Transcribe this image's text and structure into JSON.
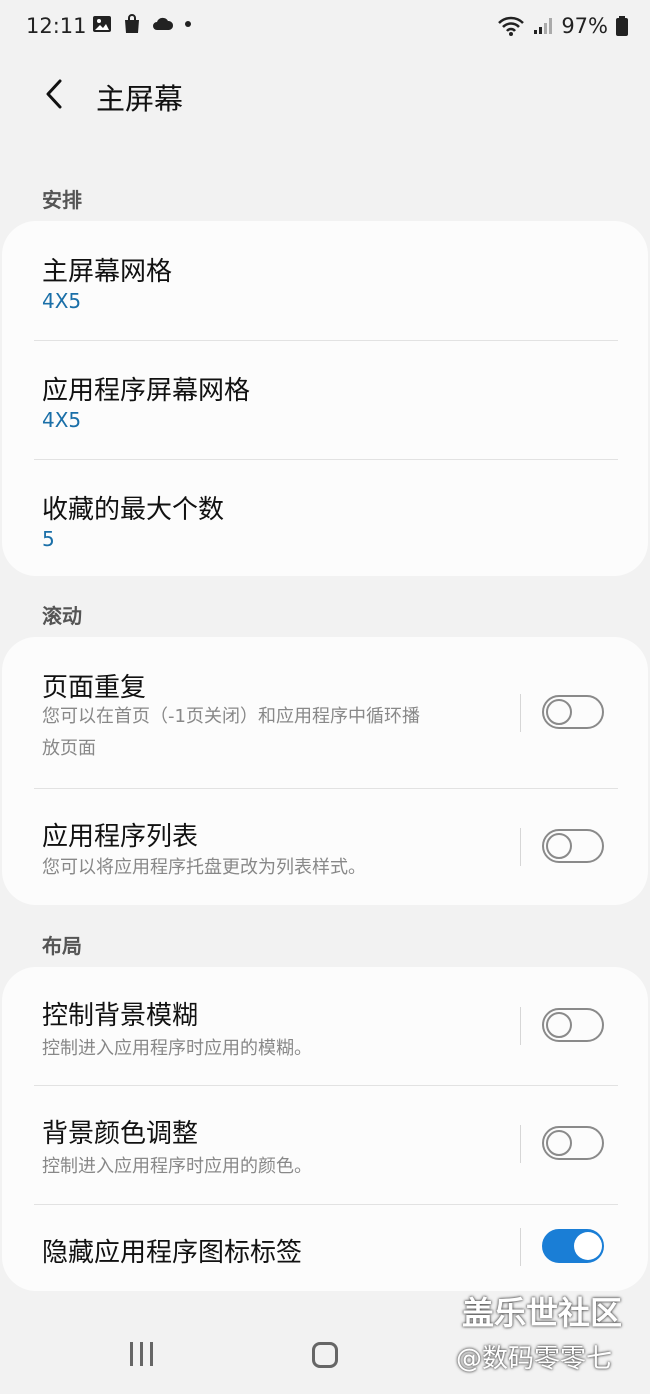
{
  "status_bar": {
    "time": "12:11",
    "battery": "97%",
    "icons": [
      "gallery-icon",
      "shopping-bag-icon",
      "cloud-icon",
      "dot-icon",
      "wifi-icon",
      "signal-icon",
      "battery-icon"
    ]
  },
  "header": {
    "title": "主屏幕",
    "back_icon": "chevron-left-icon"
  },
  "sections": {
    "arrange": {
      "label": "安排",
      "items": [
        {
          "title": "主屏幕网格",
          "value": "4X5"
        },
        {
          "title": "应用程序屏幕网格",
          "value": "4X5"
        },
        {
          "title": "收藏的最大个数",
          "value": "5"
        }
      ]
    },
    "scroll": {
      "label": "滚动",
      "items": [
        {
          "title": "页面重复",
          "desc_line1": "您可以在首页（-1页关闭）和应用程序中循环播",
          "desc_line2": "放页面",
          "toggle_on": false
        },
        {
          "title": "应用程序列表",
          "desc": "您可以将应用程序托盘更改为列表样式。",
          "toggle_on": false
        }
      ]
    },
    "layout": {
      "label": "布局",
      "items": [
        {
          "title": "控制背景模糊",
          "desc": "控制进入应用程序时应用的模糊。",
          "toggle_on": false
        },
        {
          "title": "背景颜色调整",
          "desc": "控制进入应用程序时应用的颜色。",
          "toggle_on": false
        },
        {
          "title": "隐藏应用程序图标标签",
          "toggle_on": true
        }
      ]
    }
  },
  "watermark": {
    "line1": "盖乐世社区",
    "line2": "@数码零零七"
  },
  "colors": {
    "accent": "#1a7ed6",
    "value_text": "#1a6fa8",
    "background": "#f2f2f2",
    "card": "#fcfcfc"
  }
}
